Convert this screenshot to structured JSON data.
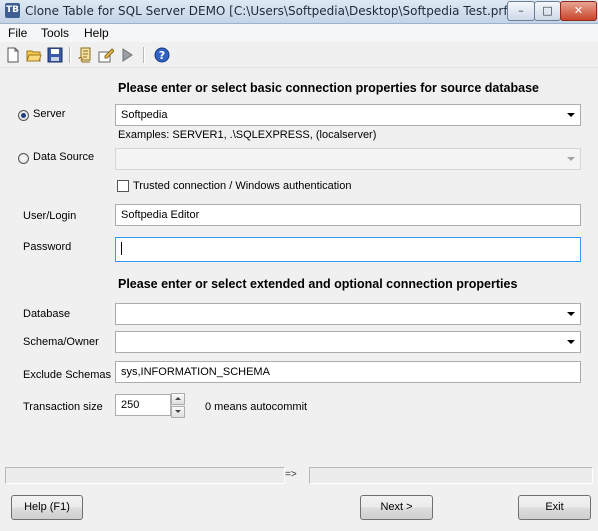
{
  "window": {
    "title": "Clone Table for SQL Server DEMO [C:\\Users\\Softpedia\\Desktop\\Softpedia Test.prf]"
  },
  "menu": {
    "items": [
      "File",
      "Tools",
      "Help"
    ]
  },
  "toolbar": {
    "icons": [
      "new-file-icon",
      "open-folder-icon",
      "save-icon",
      "script-icon",
      "edit-icon",
      "run-icon",
      "help-icon"
    ]
  },
  "source": {
    "heading": "Please enter or select basic connection properties for source database",
    "server_label": "Server",
    "server_value": "Softpedia",
    "examples": "Examples: SERVER1, .\\SQLEXPRESS, (localserver)",
    "datasource_label": "Data Source",
    "datasource_value": "",
    "trusted_label": "Trusted connection / Windows authentication",
    "user_label": "User/Login",
    "user_value": "Softpedia Editor",
    "password_label": "Password",
    "password_value": ""
  },
  "extended": {
    "heading": "Please enter or select extended and optional connection properties",
    "database_label": "Database",
    "database_value": "",
    "schema_label": "Schema/Owner",
    "schema_value": "",
    "exclude_label": "Exclude Schemas",
    "exclude_value": "sys,INFORMATION_SCHEMA",
    "transaction_label": "Transaction size",
    "transaction_value": "250",
    "transaction_hint": "0 means autocommit"
  },
  "statusbar": {
    "middle": "=>"
  },
  "buttons": {
    "help": "Help (F1)",
    "next": "Next >",
    "exit": "Exit"
  },
  "colors": {
    "titlebar": "#c3d3e6",
    "close": "#c9452b",
    "focus": "#3399ff"
  }
}
